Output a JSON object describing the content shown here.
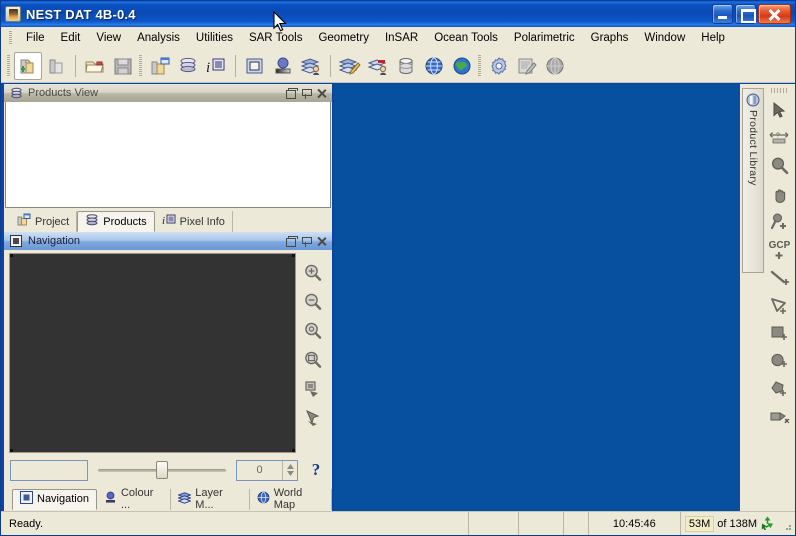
{
  "window": {
    "title": "NEST DAT 4B-0.4",
    "app_icon": "java-coffee-icon",
    "buttons": {
      "minimize": "minimize-button",
      "maximize": "maximize-button",
      "close": "close-button"
    }
  },
  "menubar": {
    "items": [
      "File",
      "Edit",
      "View",
      "Analysis",
      "Utilities",
      "SAR Tools",
      "Geometry",
      "InSAR",
      "Ocean Tools",
      "Polarimetric",
      "Graphs",
      "Window",
      "Help"
    ]
  },
  "toolbar": {
    "groups": [
      {
        "buttons": [
          {
            "name": "open-product-button",
            "icon": "folder-open-green-plus-icon",
            "selected": true
          },
          {
            "name": "close-product-button",
            "icon": "folder-close-icon",
            "selected": false
          }
        ]
      },
      {
        "buttons": [
          {
            "name": "open-file-button",
            "icon": "open-folder-icon",
            "selected": false
          },
          {
            "name": "save-button",
            "icon": "floppy-disk-icon",
            "selected": false
          }
        ]
      },
      {
        "buttons": [
          {
            "name": "project-button",
            "icon": "project-folder-icon",
            "selected": false
          },
          {
            "name": "product-library-button",
            "icon": "database-stack-icon",
            "selected": false
          },
          {
            "name": "pixel-info-button",
            "icon": "pixel-info-icon",
            "selected": false
          }
        ]
      },
      {
        "buttons": [
          {
            "name": "open-image-view-button",
            "icon": "image-view-icon",
            "selected": false
          },
          {
            "name": "colour-manipulation-button",
            "icon": "colour-palette-icon",
            "selected": false
          },
          {
            "name": "layer-manager-button",
            "icon": "layers-person-icon",
            "selected": false
          }
        ]
      },
      {
        "buttons": [
          {
            "name": "band-maths-button",
            "icon": "layers-pencil-icon",
            "selected": false
          },
          {
            "name": "layer-editor-button",
            "icon": "layers-red-person-icon",
            "selected": false
          },
          {
            "name": "database-button",
            "icon": "database-cylinder-icon",
            "selected": false
          },
          {
            "name": "world-wind-button",
            "icon": "globe-blue-icon",
            "selected": false
          },
          {
            "name": "world-map-button",
            "icon": "globe-earth-icon",
            "selected": false
          }
        ]
      },
      {
        "buttons": [
          {
            "name": "preferences-button",
            "icon": "gear-icon",
            "selected": false
          },
          {
            "name": "notepad-button",
            "icon": "notepad-pencil-icon",
            "selected": false
          },
          {
            "name": "help-sphere-button",
            "icon": "grey-sphere-icon",
            "selected": false
          }
        ]
      }
    ]
  },
  "products_panel": {
    "title": "Products View",
    "icon": "database-stack-icon",
    "header_buttons": [
      {
        "name": "float-button",
        "icon": "float-window-icon"
      },
      {
        "name": "pin-button",
        "icon": "pin-icon"
      },
      {
        "name": "close-panel-button",
        "icon": "close-icon"
      }
    ],
    "content": "",
    "tabs": [
      {
        "label": "Project",
        "icon": "project-folder-icon",
        "selected": false
      },
      {
        "label": "Products",
        "icon": "database-stack-icon",
        "selected": true
      },
      {
        "label": "Pixel Info",
        "icon": "pixel-info-icon",
        "selected": false
      }
    ]
  },
  "navigation_panel": {
    "title": "Navigation",
    "icon": "navigation-square-icon",
    "active": true,
    "header_buttons": [
      {
        "name": "float-button",
        "icon": "float-window-icon"
      },
      {
        "name": "pin-button",
        "icon": "pin-icon"
      },
      {
        "name": "close-panel-button",
        "icon": "close-icon"
      }
    ],
    "canvas_color": "#333333",
    "tools": [
      {
        "name": "zoom-in-tool",
        "icon": "magnifier-plus-icon"
      },
      {
        "name": "zoom-out-tool",
        "icon": "magnifier-minus-icon"
      },
      {
        "name": "zoom-to-pixel-tool",
        "icon": "magnifier-pixel-icon"
      },
      {
        "name": "zoom-all-tool",
        "icon": "magnifier-all-icon"
      },
      {
        "name": "sync-views-tool",
        "icon": "sync-views-icon"
      },
      {
        "name": "sync-cursor-tool",
        "icon": "sync-cursor-icon"
      }
    ],
    "controls": {
      "zoom_text": "",
      "zoom_text_placeholder": "",
      "slider_value": 50,
      "spinner_value": "0",
      "help_label": "?"
    },
    "bottom_tabs": [
      {
        "label": "Navigation",
        "icon": "navigation-square-icon",
        "selected": true
      },
      {
        "label": "Colour ...",
        "icon": "colour-palette-icon",
        "selected": false
      },
      {
        "label": "Layer M...",
        "icon": "layers-icon",
        "selected": false
      },
      {
        "label": "World Map",
        "icon": "globe-blue-icon",
        "selected": false
      }
    ]
  },
  "main_canvas": {
    "background_color": "#06509f"
  },
  "right_dock": {
    "product_library_tab": {
      "label": "Product Library",
      "icon": "library-icon"
    },
    "tools": [
      {
        "name": "selection-tool",
        "icon": "arrow-cursor-icon"
      },
      {
        "name": "range-finder-tool",
        "icon": "range-finder-icon"
      },
      {
        "name": "zoom-tool",
        "icon": "magnifier-icon"
      },
      {
        "name": "pan-tool",
        "icon": "hand-icon"
      },
      {
        "name": "pin-placing-tool",
        "icon": "pin-plus-icon"
      },
      {
        "name": "gcp-placing-tool",
        "icon": "gcp-plus-icon",
        "label": "GCP"
      },
      {
        "name": "line-drawing-tool",
        "icon": "line-plus-icon"
      },
      {
        "name": "polyline-drawing-tool",
        "icon": "polyline-plus-icon"
      },
      {
        "name": "rectangle-drawing-tool",
        "icon": "rectangle-plus-icon"
      },
      {
        "name": "ellipse-drawing-tool",
        "icon": "ellipse-plus-icon"
      },
      {
        "name": "polygon-drawing-tool",
        "icon": "polygon-plus-icon"
      },
      {
        "name": "magic-wand-tool",
        "icon": "magic-wand-icon"
      }
    ]
  },
  "statusbar": {
    "message": "Ready.",
    "time": "10:45:46",
    "memory_used": "53M",
    "memory_total_label": "of 138M",
    "gc_icon": "recycle-green-icon"
  },
  "colors": {
    "title_blue": "#0a4fbc",
    "desktop_blue": "#06509f",
    "panel_face": "#ece9d8",
    "nav_canvas": "#333333",
    "active_header": "#7fa9dd",
    "mem_highlight": "#f2edc8"
  }
}
